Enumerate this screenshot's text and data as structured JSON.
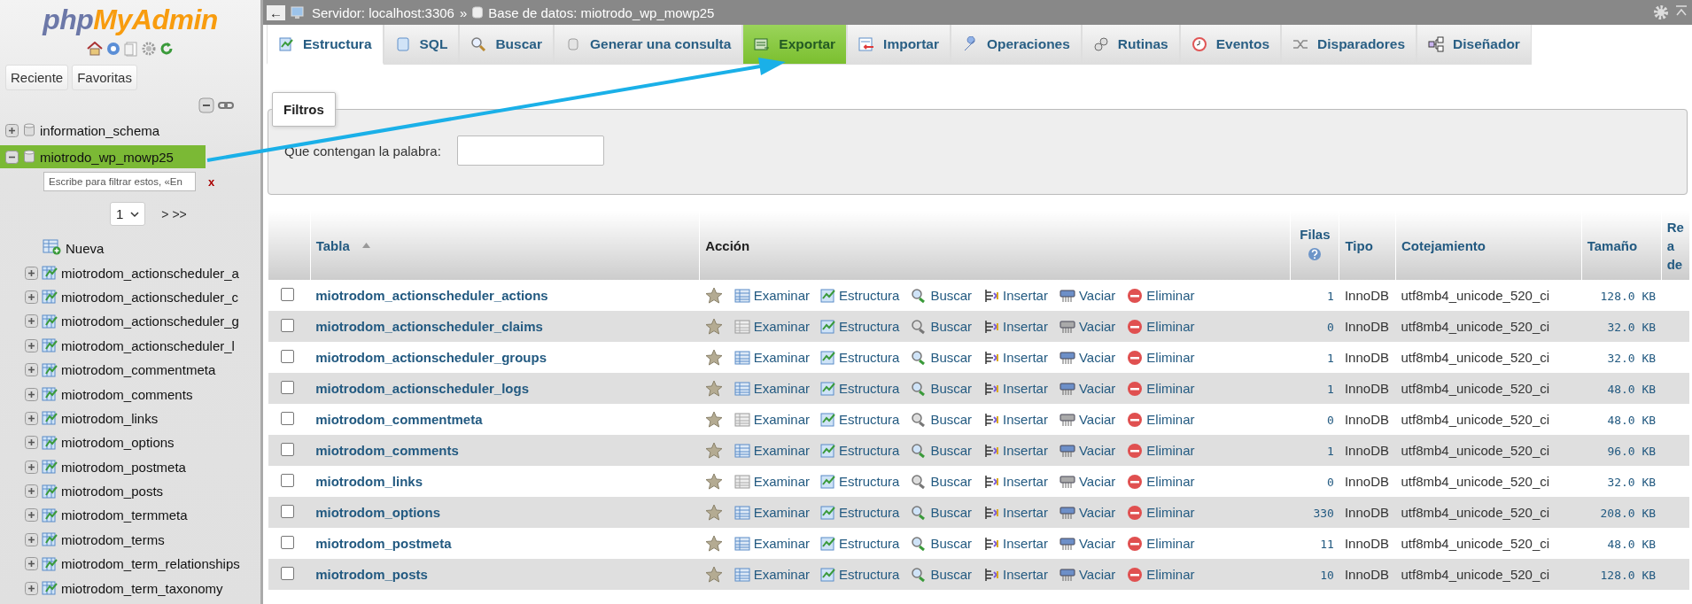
{
  "navigation": {
    "logo": {
      "part_1": "php",
      "part_2": "MyAdmin"
    },
    "buttons": [
      "Reciente",
      "Favoritas"
    ],
    "databases": [
      {
        "name": "information_schema",
        "expanded": false,
        "selected": false
      },
      {
        "name": "miotrodo_wp_mowp25",
        "expanded": true,
        "selected": true,
        "filter": {
          "placeholder": "Escribe para filtrar estos, «En"
        },
        "clear": "x",
        "page": "1",
        "pager": "> >>",
        "children": [
          {
            "name": "Nueva",
            "kind": "new"
          },
          {
            "name": "miotrodom_actionscheduler_a",
            "kind": "table"
          },
          {
            "name": "miotrodom_actionscheduler_c",
            "kind": "table"
          },
          {
            "name": "miotrodom_actionscheduler_g",
            "kind": "table"
          },
          {
            "name": "miotrodom_actionscheduler_l",
            "kind": "table"
          },
          {
            "name": "miotrodom_commentmeta",
            "kind": "table"
          },
          {
            "name": "miotrodom_comments",
            "kind": "table"
          },
          {
            "name": "miotrodom_links",
            "kind": "table"
          },
          {
            "name": "miotrodom_options",
            "kind": "table"
          },
          {
            "name": "miotrodom_postmeta",
            "kind": "table"
          },
          {
            "name": "miotrodom_posts",
            "kind": "table"
          },
          {
            "name": "miotrodom_termmeta",
            "kind": "table"
          },
          {
            "name": "miotrodom_terms",
            "kind": "table"
          },
          {
            "name": "miotrodom_term_relationships",
            "kind": "table"
          },
          {
            "name": "miotrodom_term_taxonomy",
            "kind": "table"
          }
        ]
      }
    ]
  },
  "breadcrumb": {
    "back": "←",
    "server": "Servidor: localhost:3306",
    "separator": "»",
    "database": "Base de datos: miotrodo_wp_mowp25"
  },
  "tabs": [
    {
      "label": "Estructura",
      "selected": true,
      "highlighted": false
    },
    {
      "label": "SQL",
      "selected": false,
      "highlighted": false
    },
    {
      "label": "Buscar",
      "selected": false,
      "highlighted": false
    },
    {
      "label": "Generar una consulta",
      "selected": false,
      "highlighted": false
    },
    {
      "label": "Exportar",
      "selected": false,
      "highlighted": true
    },
    {
      "label": "Importar",
      "selected": false,
      "highlighted": false
    },
    {
      "label": "Operaciones",
      "selected": false,
      "highlighted": false
    },
    {
      "label": "Rutinas",
      "selected": false,
      "highlighted": false
    },
    {
      "label": "Eventos",
      "selected": false,
      "highlighted": false
    },
    {
      "label": "Disparadores",
      "selected": false,
      "highlighted": false
    },
    {
      "label": "Diseñador",
      "selected": false,
      "highlighted": false
    }
  ],
  "filters": {
    "legend": "Filtros",
    "label": "Que contengan la palabra:"
  },
  "table": {
    "columns": [
      "Tabla",
      "Acción",
      "Filas",
      "Tipo",
      "Cotejamiento",
      "Tamaño",
      "Re a de"
    ],
    "rows": [
      {
        "checked": false,
        "name": "miotrodom_actionscheduler_actions",
        "empty": false,
        "actions": [
          "Examinar",
          "Estructura",
          "Buscar",
          "Insertar",
          "Vaciar",
          "Eliminar"
        ],
        "rows": "1",
        "type": "InnoDB",
        "collation": "utf8mb4_unicode_520_ci",
        "size": "128.0 KB"
      },
      {
        "checked": false,
        "name": "miotrodom_actionscheduler_claims",
        "empty": true,
        "actions": [
          "Examinar",
          "Estructura",
          "Buscar",
          "Insertar",
          "Vaciar",
          "Eliminar"
        ],
        "rows": "0",
        "type": "InnoDB",
        "collation": "utf8mb4_unicode_520_ci",
        "size": "32.0 KB"
      },
      {
        "checked": false,
        "name": "miotrodom_actionscheduler_groups",
        "empty": false,
        "actions": [
          "Examinar",
          "Estructura",
          "Buscar",
          "Insertar",
          "Vaciar",
          "Eliminar"
        ],
        "rows": "1",
        "type": "InnoDB",
        "collation": "utf8mb4_unicode_520_ci",
        "size": "32.0 KB"
      },
      {
        "checked": false,
        "name": "miotrodom_actionscheduler_logs",
        "empty": false,
        "actions": [
          "Examinar",
          "Estructura",
          "Buscar",
          "Insertar",
          "Vaciar",
          "Eliminar"
        ],
        "rows": "1",
        "type": "InnoDB",
        "collation": "utf8mb4_unicode_520_ci",
        "size": "48.0 KB"
      },
      {
        "checked": false,
        "name": "miotrodom_commentmeta",
        "empty": true,
        "actions": [
          "Examinar",
          "Estructura",
          "Buscar",
          "Insertar",
          "Vaciar",
          "Eliminar"
        ],
        "rows": "0",
        "type": "InnoDB",
        "collation": "utf8mb4_unicode_520_ci",
        "size": "48.0 KB"
      },
      {
        "checked": false,
        "name": "miotrodom_comments",
        "empty": false,
        "actions": [
          "Examinar",
          "Estructura",
          "Buscar",
          "Insertar",
          "Vaciar",
          "Eliminar"
        ],
        "rows": "1",
        "type": "InnoDB",
        "collation": "utf8mb4_unicode_520_ci",
        "size": "96.0 KB"
      },
      {
        "checked": false,
        "name": "miotrodom_links",
        "empty": true,
        "actions": [
          "Examinar",
          "Estructura",
          "Buscar",
          "Insertar",
          "Vaciar",
          "Eliminar"
        ],
        "rows": "0",
        "type": "InnoDB",
        "collation": "utf8mb4_unicode_520_ci",
        "size": "32.0 KB"
      },
      {
        "checked": false,
        "name": "miotrodom_options",
        "empty": false,
        "actions": [
          "Examinar",
          "Estructura",
          "Buscar",
          "Insertar",
          "Vaciar",
          "Eliminar"
        ],
        "rows": "330",
        "type": "InnoDB",
        "collation": "utf8mb4_unicode_520_ci",
        "size": "208.0 KB"
      },
      {
        "checked": false,
        "name": "miotrodom_postmeta",
        "empty": false,
        "actions": [
          "Examinar",
          "Estructura",
          "Buscar",
          "Insertar",
          "Vaciar",
          "Eliminar"
        ],
        "rows": "11",
        "type": "InnoDB",
        "collation": "utf8mb4_unicode_520_ci",
        "size": "48.0 KB"
      },
      {
        "checked": false,
        "name": "miotrodom_posts",
        "empty": false,
        "actions": [
          "Examinar",
          "Estructura",
          "Buscar",
          "Insertar",
          "Vaciar",
          "Eliminar"
        ],
        "rows": "10",
        "type": "InnoDB",
        "collation": "utf8mb4_unicode_520_ci",
        "size": "128.0 KB"
      }
    ]
  }
}
